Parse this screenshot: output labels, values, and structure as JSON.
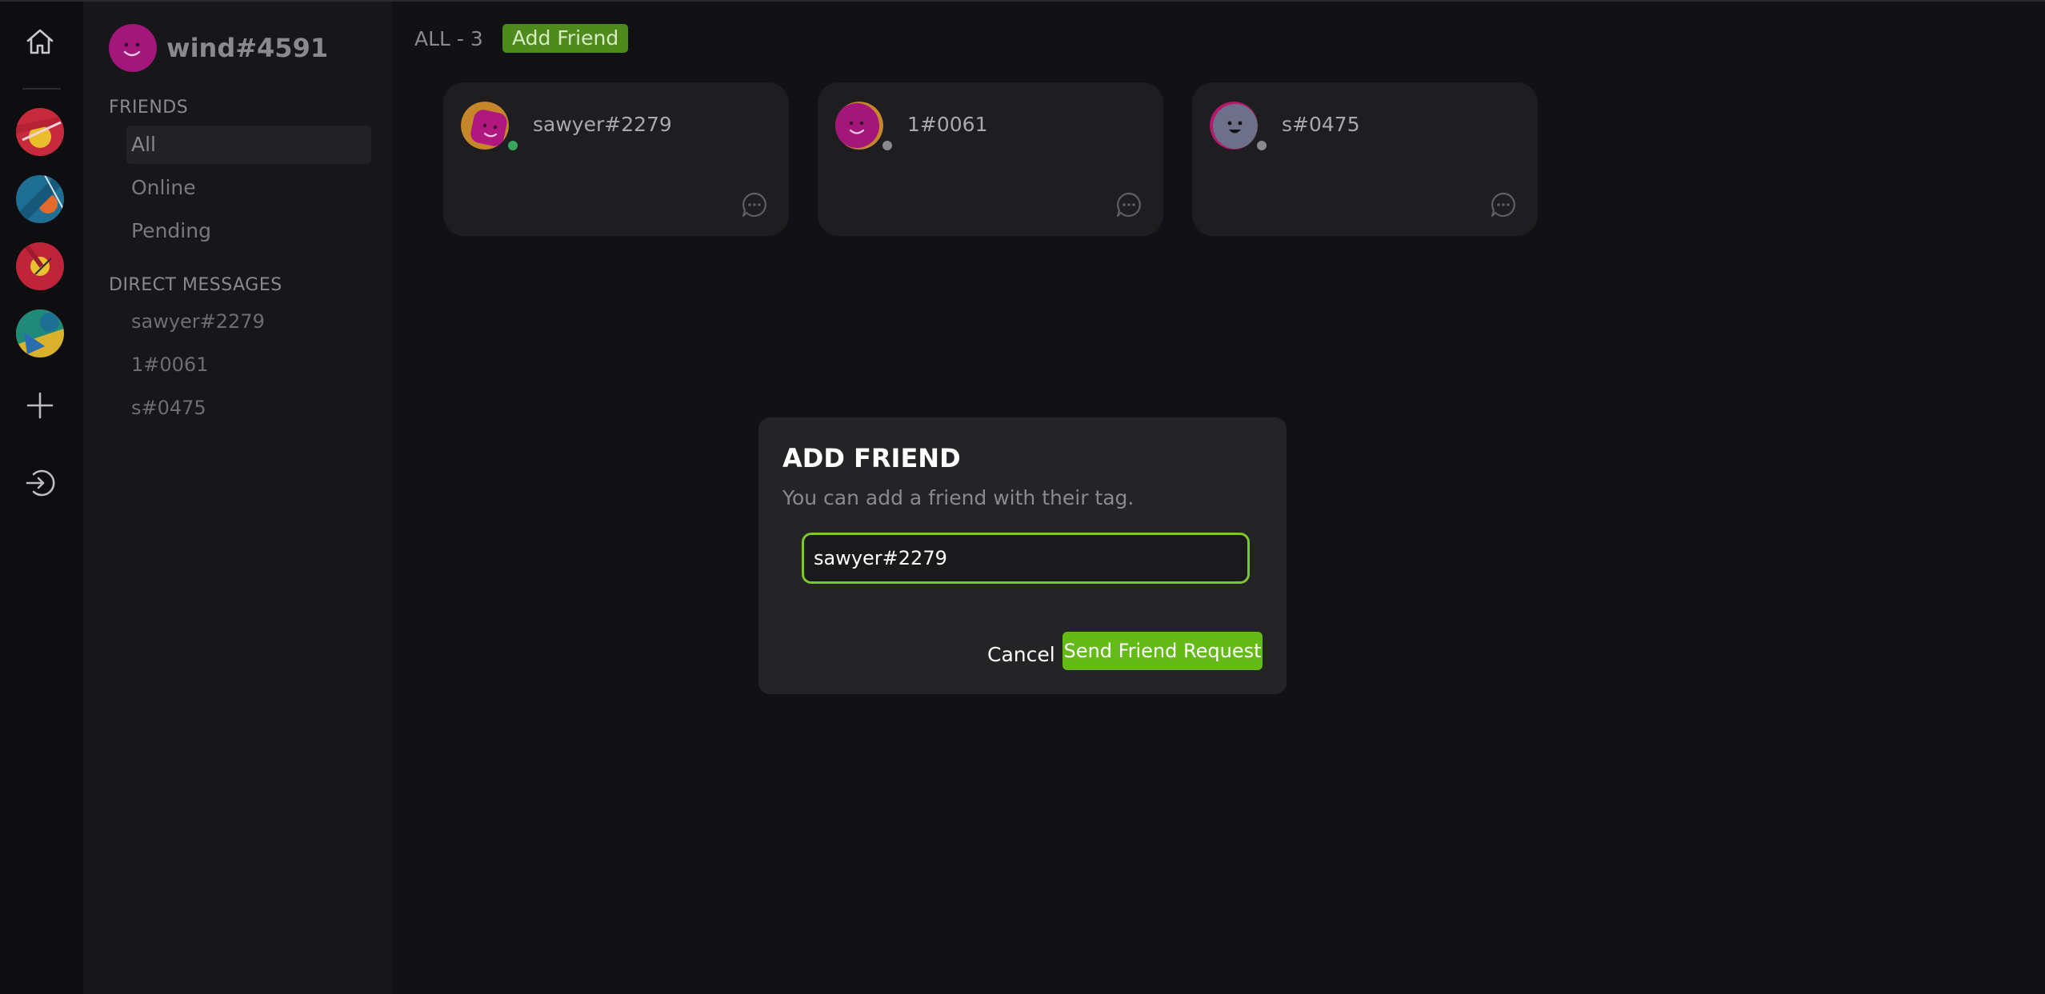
{
  "user": {
    "name": "wind#4591"
  },
  "rail": {
    "icons": [
      "home-icon",
      "plus-icon",
      "logout-icon"
    ],
    "servers": [
      "server-1",
      "server-2",
      "server-3",
      "server-4"
    ]
  },
  "sidebar": {
    "friends_heading": "FRIENDS",
    "nav": [
      {
        "label": "All",
        "active": true
      },
      {
        "label": "Online",
        "active": false
      },
      {
        "label": "Pending",
        "active": false
      }
    ],
    "dm_heading": "DIRECT MESSAGES",
    "dms": [
      "sawyer#2279",
      "1#0061",
      "s#0475"
    ]
  },
  "main": {
    "count_label": "ALL - 3",
    "add_friend_label": "Add Friend",
    "friends": [
      {
        "name": "sawyer#2279",
        "status": "online",
        "status_color": "#3ba55d"
      },
      {
        "name": "1#0061",
        "status": "offline",
        "status_color": "#8a8a8e"
      },
      {
        "name": "s#0475",
        "status": "offline",
        "status_color": "#8a8a8e"
      }
    ]
  },
  "modal": {
    "title": "ADD FRIEND",
    "subtitle": "You can add a friend with their tag.",
    "input_value": "sawyer#2279",
    "cancel_label": "Cancel",
    "submit_label": "Send Friend Request"
  },
  "colors": {
    "accent": "#64ba16",
    "input_border": "#7cc72c",
    "background": "#121214",
    "sidebar": "#17171a",
    "card": "#1e1e21",
    "modal": "#242427"
  }
}
